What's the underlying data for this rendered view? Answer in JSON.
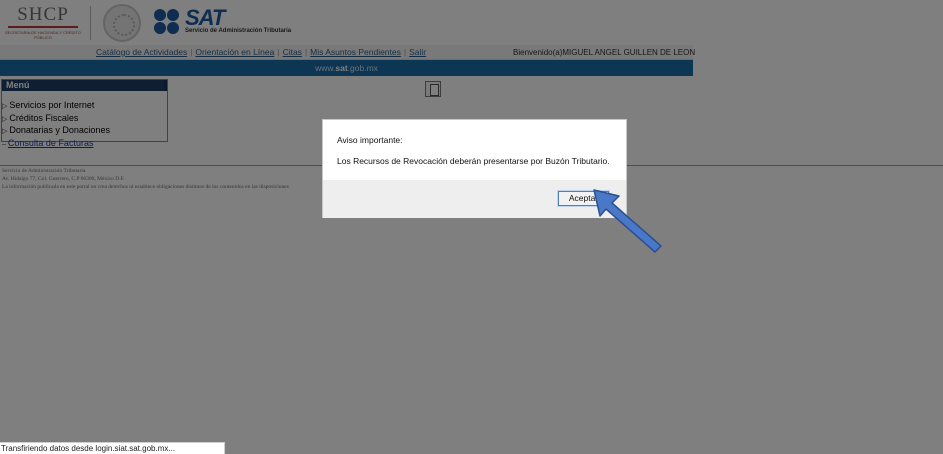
{
  "header": {
    "shcp_logo_text": "SHCP",
    "shcp_logo_subtext": "SECRETARÍA DE HACIENDA Y CRÉDITO PÚBLICO",
    "sat_logo_text": "SAT",
    "sat_logo_subtext": "Servicio de Administración Tributaria"
  },
  "nav": {
    "links": [
      "Catálogo de Actividades",
      "Orientación en Línea",
      "Citas",
      "Mis Asuntos Pendientes",
      "Salir"
    ],
    "welcome": "Bienvenido(a)MIGUEL ANGEL GUILLEN DE LEON"
  },
  "banner": {
    "prefix": "www.",
    "domain": "sat",
    "suffix": ".gob.mx"
  },
  "menu": {
    "title": "Menú",
    "items": [
      {
        "label": "Servicios por Internet",
        "marker": "▷"
      },
      {
        "label": "Créditos Fiscales",
        "marker": "▷"
      },
      {
        "label": "Donatarias y Donaciones",
        "marker": "▷"
      },
      {
        "label": "Consulta de Facturas",
        "marker": "–"
      }
    ]
  },
  "footer": {
    "line1": "Servicio de Administración Tributaria",
    "line2": "Av. Hidalgo 77, Col. Guerrero, C.P 06300, México D.F.",
    "line3": "La información publicada en este portal no crea derechos ni establece obligaciones distintos de los contenidos en las disposiciones"
  },
  "status_bar": {
    "text": "Transfiriendo datos desde login.siat.sat.gob.mx..."
  },
  "dialog": {
    "title": "Aviso importante:",
    "message": "Los Recursos de Revocación deberán presentarse por Buzón Tributario.",
    "accept_label": "Aceptar"
  },
  "annotation": {
    "arrow_color": "#4a78c8"
  }
}
